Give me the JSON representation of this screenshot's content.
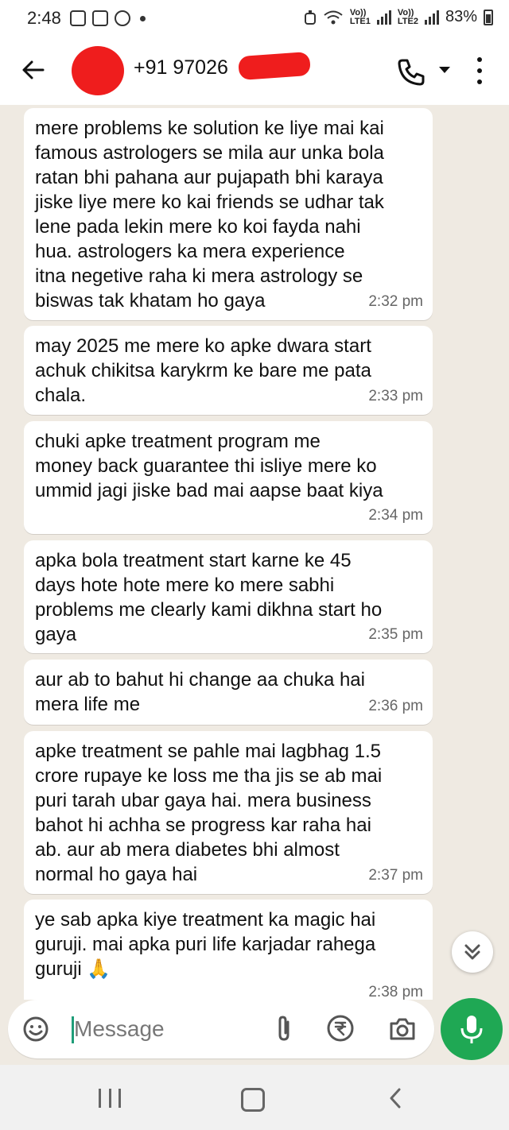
{
  "status_bar": {
    "time": "2:48",
    "battery": "83%",
    "sim1": "LTE1",
    "sim2": "LTE2",
    "vol_label": "Vo))"
  },
  "header": {
    "contact_number": "+91 97026",
    "icons": [
      "back-arrow-icon",
      "phone-icon",
      "chevron-down-icon",
      "more-vert-icon"
    ]
  },
  "messages": [
    {
      "text": "mere problems ke solution ke liye mai kai\nfamous astrologers se mila aur unka bola\nratan bhi pahana aur pujapath bhi karaya\njiske liye mere ko kai friends se udhar tak\nlene pada lekin mere ko koi fayda nahi\nhua. astrologers ka mera experience\nitna negetive raha ki mera astrology se\nbiswas tak khatam ho gaya",
      "time": "2:32 pm"
    },
    {
      "text": "may 2025 me mere ko apke dwara start\nachuk chikitsa karykrm ke bare me pata\nchala.",
      "time": "2:33 pm"
    },
    {
      "text": "chuki apke treatment program me\nmoney back guarantee thi isliye mere ko\nummid jagi jiske bad mai aapse baat kiya",
      "time": "2:34 pm"
    },
    {
      "text": "apka bola treatment start karne ke 45\ndays hote hote mere ko mere sabhi\nproblems me clearly kami dikhna start ho\ngaya",
      "time": "2:35 pm"
    },
    {
      "text": "aur ab to bahut hi change aa chuka hai\nmera life me",
      "time": "2:36 pm"
    },
    {
      "text": "apke treatment se pahle mai lagbhag 1.5\ncrore rupaye ke loss me tha jis se ab mai\npuri tarah ubar gaya hai. mera business\nbahot hi achha se progress kar raha hai\nab. aur ab mera diabetes bhi almost\nnormal ho gaya hai",
      "time": "2:37 pm"
    },
    {
      "text": "ye sab apka kiye treatment ka magic hai\nguruji. mai apka puri life karjadar rahega\nguruji 🙏",
      "time": "2:38 pm"
    }
  ],
  "composer": {
    "placeholder": "Message"
  },
  "colors": {
    "accent_green": "#1fa854",
    "chat_background": "#efeae2",
    "bubble": "#ffffff",
    "redaction": "#ef1d1d"
  }
}
